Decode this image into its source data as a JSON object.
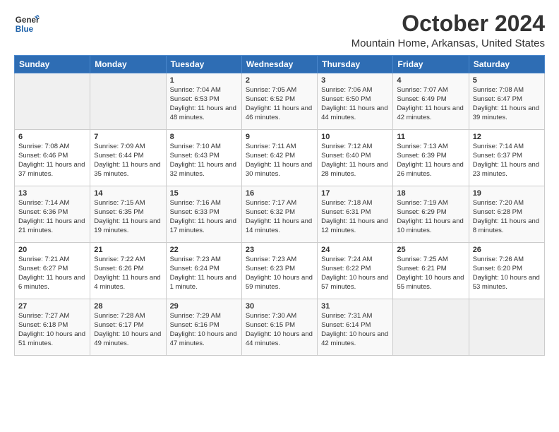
{
  "logo": {
    "text_general": "General",
    "text_blue": "Blue"
  },
  "header": {
    "month_year": "October 2024",
    "location": "Mountain Home, Arkansas, United States"
  },
  "days_of_week": [
    "Sunday",
    "Monday",
    "Tuesday",
    "Wednesday",
    "Thursday",
    "Friday",
    "Saturday"
  ],
  "weeks": [
    [
      {
        "day": "",
        "info": ""
      },
      {
        "day": "",
        "info": ""
      },
      {
        "day": "1",
        "info": "Sunrise: 7:04 AM\nSunset: 6:53 PM\nDaylight: 11 hours and 48 minutes."
      },
      {
        "day": "2",
        "info": "Sunrise: 7:05 AM\nSunset: 6:52 PM\nDaylight: 11 hours and 46 minutes."
      },
      {
        "day": "3",
        "info": "Sunrise: 7:06 AM\nSunset: 6:50 PM\nDaylight: 11 hours and 44 minutes."
      },
      {
        "day": "4",
        "info": "Sunrise: 7:07 AM\nSunset: 6:49 PM\nDaylight: 11 hours and 42 minutes."
      },
      {
        "day": "5",
        "info": "Sunrise: 7:08 AM\nSunset: 6:47 PM\nDaylight: 11 hours and 39 minutes."
      }
    ],
    [
      {
        "day": "6",
        "info": "Sunrise: 7:08 AM\nSunset: 6:46 PM\nDaylight: 11 hours and 37 minutes."
      },
      {
        "day": "7",
        "info": "Sunrise: 7:09 AM\nSunset: 6:44 PM\nDaylight: 11 hours and 35 minutes."
      },
      {
        "day": "8",
        "info": "Sunrise: 7:10 AM\nSunset: 6:43 PM\nDaylight: 11 hours and 32 minutes."
      },
      {
        "day": "9",
        "info": "Sunrise: 7:11 AM\nSunset: 6:42 PM\nDaylight: 11 hours and 30 minutes."
      },
      {
        "day": "10",
        "info": "Sunrise: 7:12 AM\nSunset: 6:40 PM\nDaylight: 11 hours and 28 minutes."
      },
      {
        "day": "11",
        "info": "Sunrise: 7:13 AM\nSunset: 6:39 PM\nDaylight: 11 hours and 26 minutes."
      },
      {
        "day": "12",
        "info": "Sunrise: 7:14 AM\nSunset: 6:37 PM\nDaylight: 11 hours and 23 minutes."
      }
    ],
    [
      {
        "day": "13",
        "info": "Sunrise: 7:14 AM\nSunset: 6:36 PM\nDaylight: 11 hours and 21 minutes."
      },
      {
        "day": "14",
        "info": "Sunrise: 7:15 AM\nSunset: 6:35 PM\nDaylight: 11 hours and 19 minutes."
      },
      {
        "day": "15",
        "info": "Sunrise: 7:16 AM\nSunset: 6:33 PM\nDaylight: 11 hours and 17 minutes."
      },
      {
        "day": "16",
        "info": "Sunrise: 7:17 AM\nSunset: 6:32 PM\nDaylight: 11 hours and 14 minutes."
      },
      {
        "day": "17",
        "info": "Sunrise: 7:18 AM\nSunset: 6:31 PM\nDaylight: 11 hours and 12 minutes."
      },
      {
        "day": "18",
        "info": "Sunrise: 7:19 AM\nSunset: 6:29 PM\nDaylight: 11 hours and 10 minutes."
      },
      {
        "day": "19",
        "info": "Sunrise: 7:20 AM\nSunset: 6:28 PM\nDaylight: 11 hours and 8 minutes."
      }
    ],
    [
      {
        "day": "20",
        "info": "Sunrise: 7:21 AM\nSunset: 6:27 PM\nDaylight: 11 hours and 6 minutes."
      },
      {
        "day": "21",
        "info": "Sunrise: 7:22 AM\nSunset: 6:26 PM\nDaylight: 11 hours and 4 minutes."
      },
      {
        "day": "22",
        "info": "Sunrise: 7:23 AM\nSunset: 6:24 PM\nDaylight: 11 hours and 1 minute."
      },
      {
        "day": "23",
        "info": "Sunrise: 7:23 AM\nSunset: 6:23 PM\nDaylight: 10 hours and 59 minutes."
      },
      {
        "day": "24",
        "info": "Sunrise: 7:24 AM\nSunset: 6:22 PM\nDaylight: 10 hours and 57 minutes."
      },
      {
        "day": "25",
        "info": "Sunrise: 7:25 AM\nSunset: 6:21 PM\nDaylight: 10 hours and 55 minutes."
      },
      {
        "day": "26",
        "info": "Sunrise: 7:26 AM\nSunset: 6:20 PM\nDaylight: 10 hours and 53 minutes."
      }
    ],
    [
      {
        "day": "27",
        "info": "Sunrise: 7:27 AM\nSunset: 6:18 PM\nDaylight: 10 hours and 51 minutes."
      },
      {
        "day": "28",
        "info": "Sunrise: 7:28 AM\nSunset: 6:17 PM\nDaylight: 10 hours and 49 minutes."
      },
      {
        "day": "29",
        "info": "Sunrise: 7:29 AM\nSunset: 6:16 PM\nDaylight: 10 hours and 47 minutes."
      },
      {
        "day": "30",
        "info": "Sunrise: 7:30 AM\nSunset: 6:15 PM\nDaylight: 10 hours and 44 minutes."
      },
      {
        "day": "31",
        "info": "Sunrise: 7:31 AM\nSunset: 6:14 PM\nDaylight: 10 hours and 42 minutes."
      },
      {
        "day": "",
        "info": ""
      },
      {
        "day": "",
        "info": ""
      }
    ]
  ]
}
